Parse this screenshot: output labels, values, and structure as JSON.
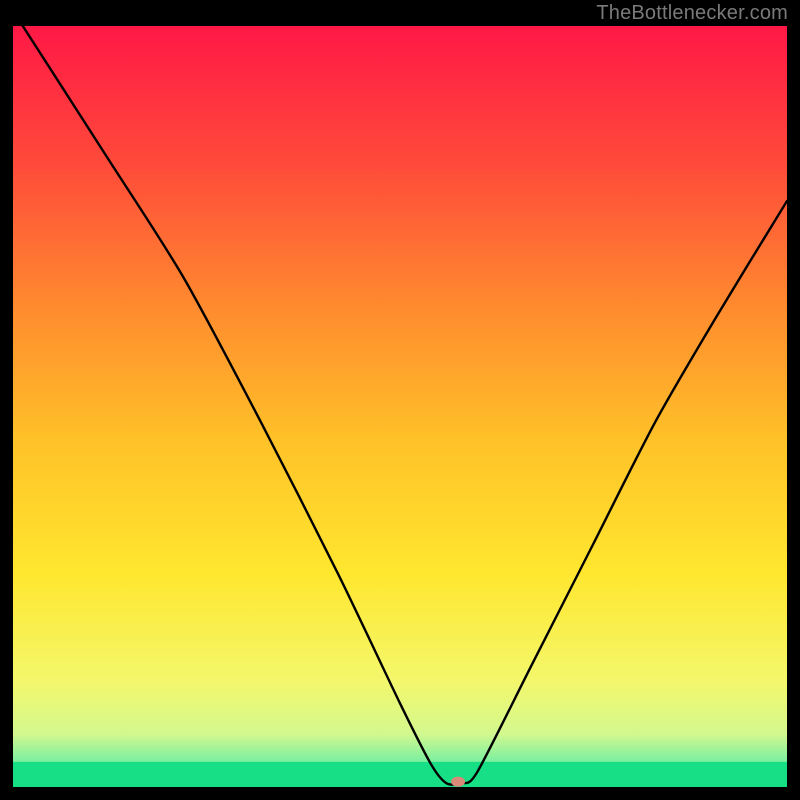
{
  "watermark": "TheBottlenecker.com",
  "chart_data": {
    "type": "line",
    "title": "",
    "xlabel": "",
    "ylabel": "",
    "xlim": [
      0,
      100
    ],
    "ylim": [
      0,
      100
    ],
    "series": [
      {
        "name": "bottleneck-curve",
        "x": [
          0,
          12,
          22,
          32,
          42,
          50,
          54,
          56,
          58,
          60,
          67,
          75,
          83,
          91,
          100
        ],
        "y": [
          102,
          83,
          67,
          48,
          28,
          11,
          3,
          0.5,
          0.5,
          2,
          16,
          32,
          48,
          62,
          77
        ]
      }
    ],
    "marker": {
      "x": 57.5,
      "y": 0.7,
      "color": "#d98a78"
    },
    "optimal_band": {
      "ymin": 0,
      "ymax": 3.3
    },
    "gradient_stops": [
      {
        "offset": 0.0,
        "color": "#ff1846"
      },
      {
        "offset": 0.18,
        "color": "#ff4a3a"
      },
      {
        "offset": 0.38,
        "color": "#ff8e2e"
      },
      {
        "offset": 0.55,
        "color": "#ffc328"
      },
      {
        "offset": 0.72,
        "color": "#ffe72f"
      },
      {
        "offset": 0.86,
        "color": "#f4f76b"
      },
      {
        "offset": 0.93,
        "color": "#d3f88e"
      },
      {
        "offset": 0.965,
        "color": "#7ef0a0"
      },
      {
        "offset": 0.99,
        "color": "#1fe08a"
      },
      {
        "offset": 1.0,
        "color": "#0fd87f"
      }
    ]
  }
}
